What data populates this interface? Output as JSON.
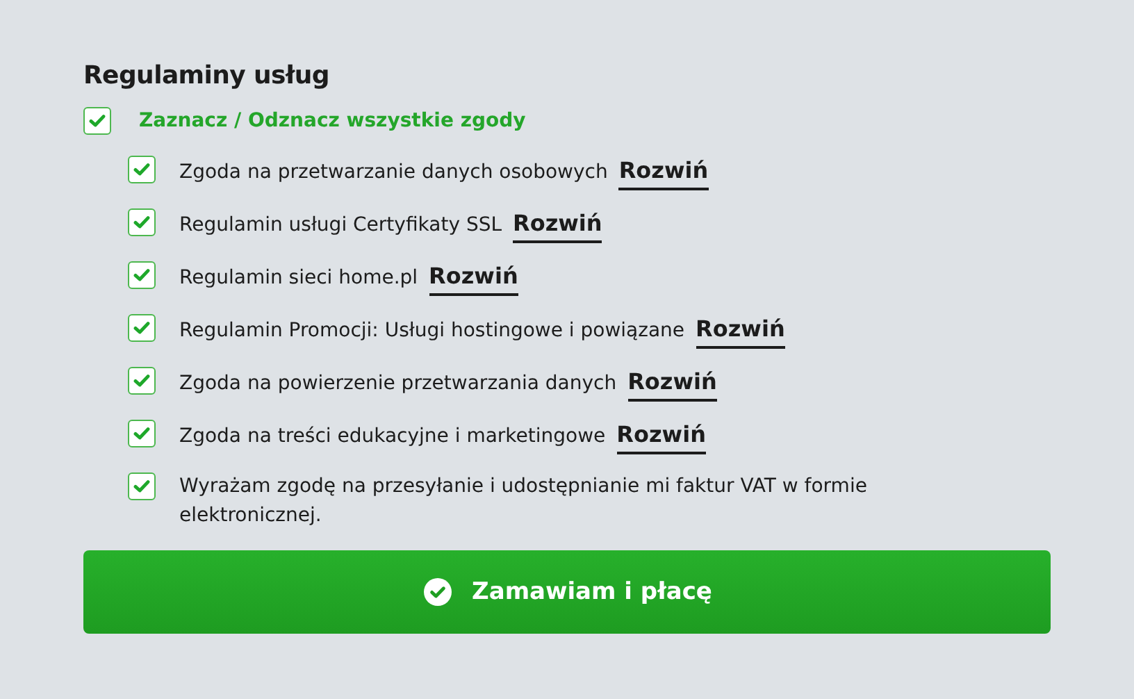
{
  "heading": "Regulaminy usług",
  "select_all": {
    "label": "Zaznacz / Odznacz wszystkie zgody",
    "checked": true
  },
  "consents": [
    {
      "label": "Zgoda na przetwarzanie danych osobowych",
      "checked": true,
      "expand": "Rozwiń"
    },
    {
      "label": "Regulamin usługi Certyfikaty SSL",
      "checked": true,
      "expand": "Rozwiń"
    },
    {
      "label": "Regulamin sieci home.pl",
      "checked": true,
      "expand": "Rozwiń"
    },
    {
      "label": "Regulamin Promocji: Usługi hostingowe i powiązane",
      "checked": true,
      "expand": "Rozwiń"
    },
    {
      "label": "Zgoda na powierzenie przetwarzania danych",
      "checked": true,
      "expand": "Rozwiń"
    },
    {
      "label": "Zgoda na treści edukacyjne i marketingowe",
      "checked": true,
      "expand": "Rozwiń"
    },
    {
      "label": "Wyrażam zgodę na przesyłanie i udostępnianie mi faktur VAT w formie elektronicznej.",
      "checked": true
    }
  ],
  "submit": {
    "label": "Zamawiam i płacę"
  }
}
